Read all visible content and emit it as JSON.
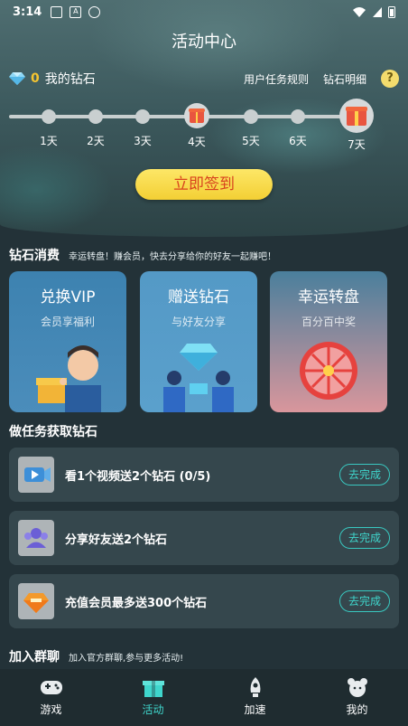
{
  "status": {
    "time": "3:14"
  },
  "header": {
    "title": "活动中心"
  },
  "diamonds": {
    "count": "0",
    "label": "我的钻石",
    "rules_link": "用户任务规则",
    "detail_link": "钻石明细",
    "help": "?"
  },
  "checkin": {
    "days": [
      "1天",
      "2天",
      "3天",
      "4天",
      "5天",
      "6天",
      "7天"
    ],
    "button": "立即签到"
  },
  "consume": {
    "title": "钻石消费",
    "subtitle": "幸运转盘！赚会员，快去分享给你的好友一起赚吧！",
    "cards": [
      {
        "title": "兑换VIP",
        "sub": "会员享福利"
      },
      {
        "title": "赠送钻石",
        "sub": "与好友分享"
      },
      {
        "title": "幸运转盘",
        "sub": "百分百中奖"
      }
    ]
  },
  "tasks": {
    "title": "做任务获取钻石",
    "items": [
      {
        "text": "看1个视频送2个钻石 (0/5)",
        "button": "去完成",
        "icon": "video-icon"
      },
      {
        "text": "分享好友送2个钻石",
        "button": "去完成",
        "icon": "friends-icon"
      },
      {
        "text": "充值会员最多送300个钻石",
        "button": "去完成",
        "icon": "vip-diamond-icon"
      }
    ]
  },
  "group": {
    "title": "加入群聊",
    "subtitle": "加入官方群聊,参与更多活动!"
  },
  "tabs": [
    {
      "label": "游戏",
      "icon": "gamepad-icon"
    },
    {
      "label": "活动",
      "icon": "gift-icon"
    },
    {
      "label": "加速",
      "icon": "rocket-icon"
    },
    {
      "label": "我的",
      "icon": "profile-icon"
    }
  ],
  "colors": {
    "accent": "#3fd6cc",
    "gold": "#f6c530",
    "button": "#f3cf34"
  }
}
